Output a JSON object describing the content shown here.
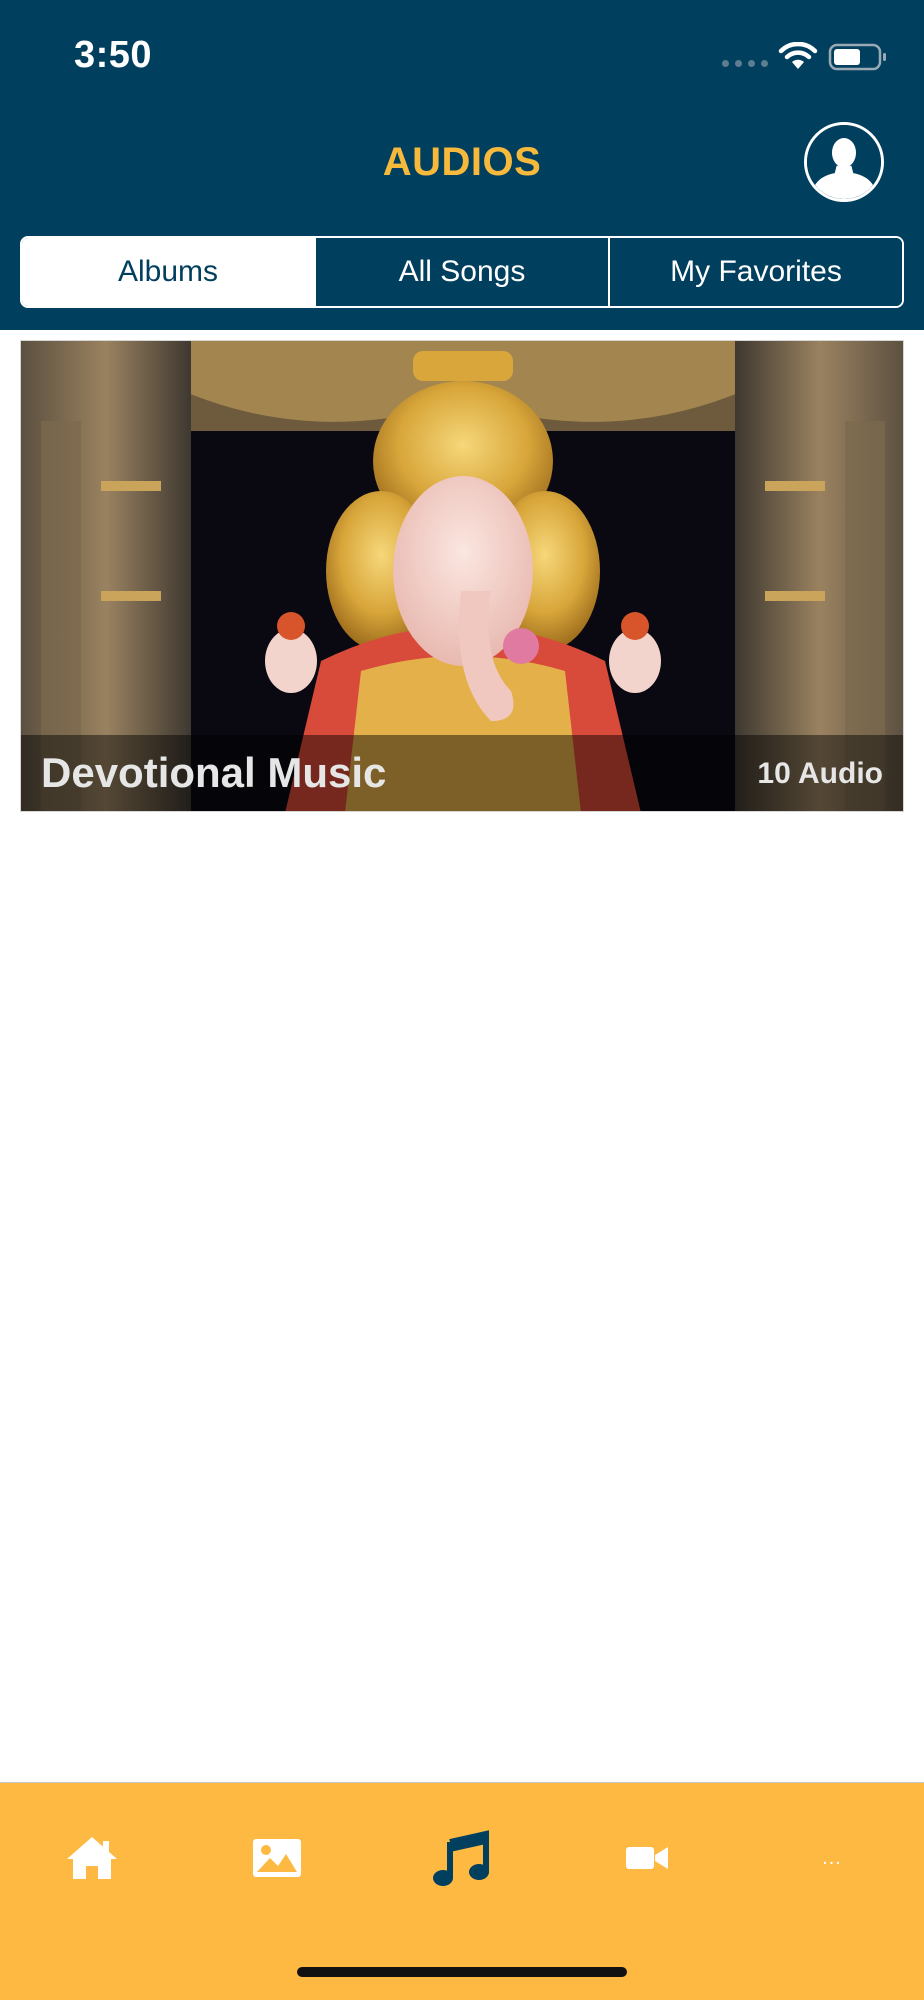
{
  "status_bar": {
    "time": "3:50"
  },
  "header": {
    "title": "AUDIOS",
    "profile_icon": "user-silhouette-icon"
  },
  "segments": {
    "items": [
      {
        "label": "Albums",
        "selected": true
      },
      {
        "label": "All Songs",
        "selected": false
      },
      {
        "label": "My Favorites",
        "selected": false
      }
    ]
  },
  "albums": [
    {
      "title": "Devotional Music",
      "count": "10 Audio",
      "image": "ganesha-idol-photo"
    }
  ],
  "tab_bar": {
    "items": [
      {
        "icon": "home-icon",
        "selected": false
      },
      {
        "icon": "image-icon",
        "selected": false
      },
      {
        "icon": "music-note-icon",
        "selected": true
      },
      {
        "icon": "video-camera-icon",
        "selected": false
      },
      {
        "icon": "more-icon",
        "label": "...",
        "selected": false
      }
    ]
  },
  "colors": {
    "header_bg": "#003f5e",
    "title": "#f6b93b",
    "tab_bar_bg": "#fdb942",
    "active_tab_icon": "#003f5e",
    "inactive_tab_icon": "#ffffff"
  }
}
